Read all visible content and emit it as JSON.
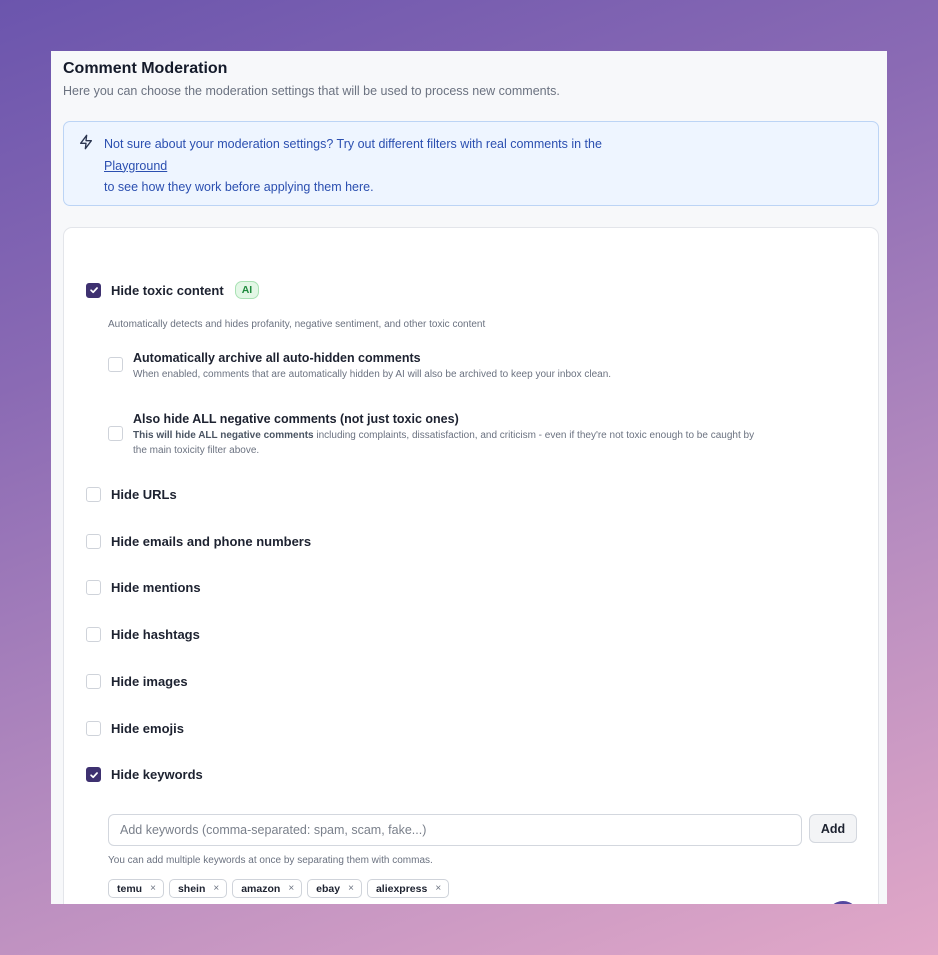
{
  "header": {
    "title": "Comment Moderation",
    "subtitle": "Here you can choose the moderation settings that will be used to process new comments."
  },
  "info": {
    "icon": "lightning-icon",
    "line1": "Not sure about your moderation settings? Try out different filters with real comments in the",
    "link": "Playground",
    "line3": "to see how they work before applying them here."
  },
  "toxic": {
    "label": "Hide toxic content",
    "checked": true,
    "badge": "AI",
    "helper": "Automatically detects and hides profanity, negative sentiment, and other toxic content",
    "archive": {
      "title": "Automatically archive all auto-hidden comments",
      "desc": "When enabled, comments that are automatically hidden by AI will also be archived to keep your inbox clean.",
      "checked": false
    },
    "negative": {
      "title": "Also hide ALL negative comments (not just toxic ones)",
      "desc_bold": "This will hide ALL negative comments",
      "desc_line1": " including complaints, dissatisfaction, and criticism - even if they're not toxic enough to be caught by",
      "desc_line2": "the main toxicity filter above.",
      "checked": false
    }
  },
  "options": {
    "urls": {
      "label": "Hide URLs",
      "checked": false
    },
    "emails": {
      "label": "Hide emails and phone numbers",
      "checked": false
    },
    "mentions": {
      "label": "Hide mentions",
      "checked": false
    },
    "hashtags": {
      "label": "Hide hashtags",
      "checked": false
    },
    "images": {
      "label": "Hide images",
      "checked": false
    },
    "emojis": {
      "label": "Hide emojis",
      "checked": false
    },
    "keywords": {
      "label": "Hide keywords",
      "checked": true
    }
  },
  "keywords": {
    "placeholder": "Add keywords (comma-separated: spam, scam, fake...)",
    "add_label": "Add",
    "helper": "You can add multiple keywords at once by separating them with commas.",
    "chips": [
      "temu",
      "shein",
      "amazon",
      "ebay",
      "aliexpress"
    ],
    "remove_symbol": "×"
  },
  "colors": {
    "accent": "#3e3170",
    "info_bg": "#eef5ff",
    "info_text": "#2b4fb0",
    "badge_green": "#1f8a3e"
  }
}
